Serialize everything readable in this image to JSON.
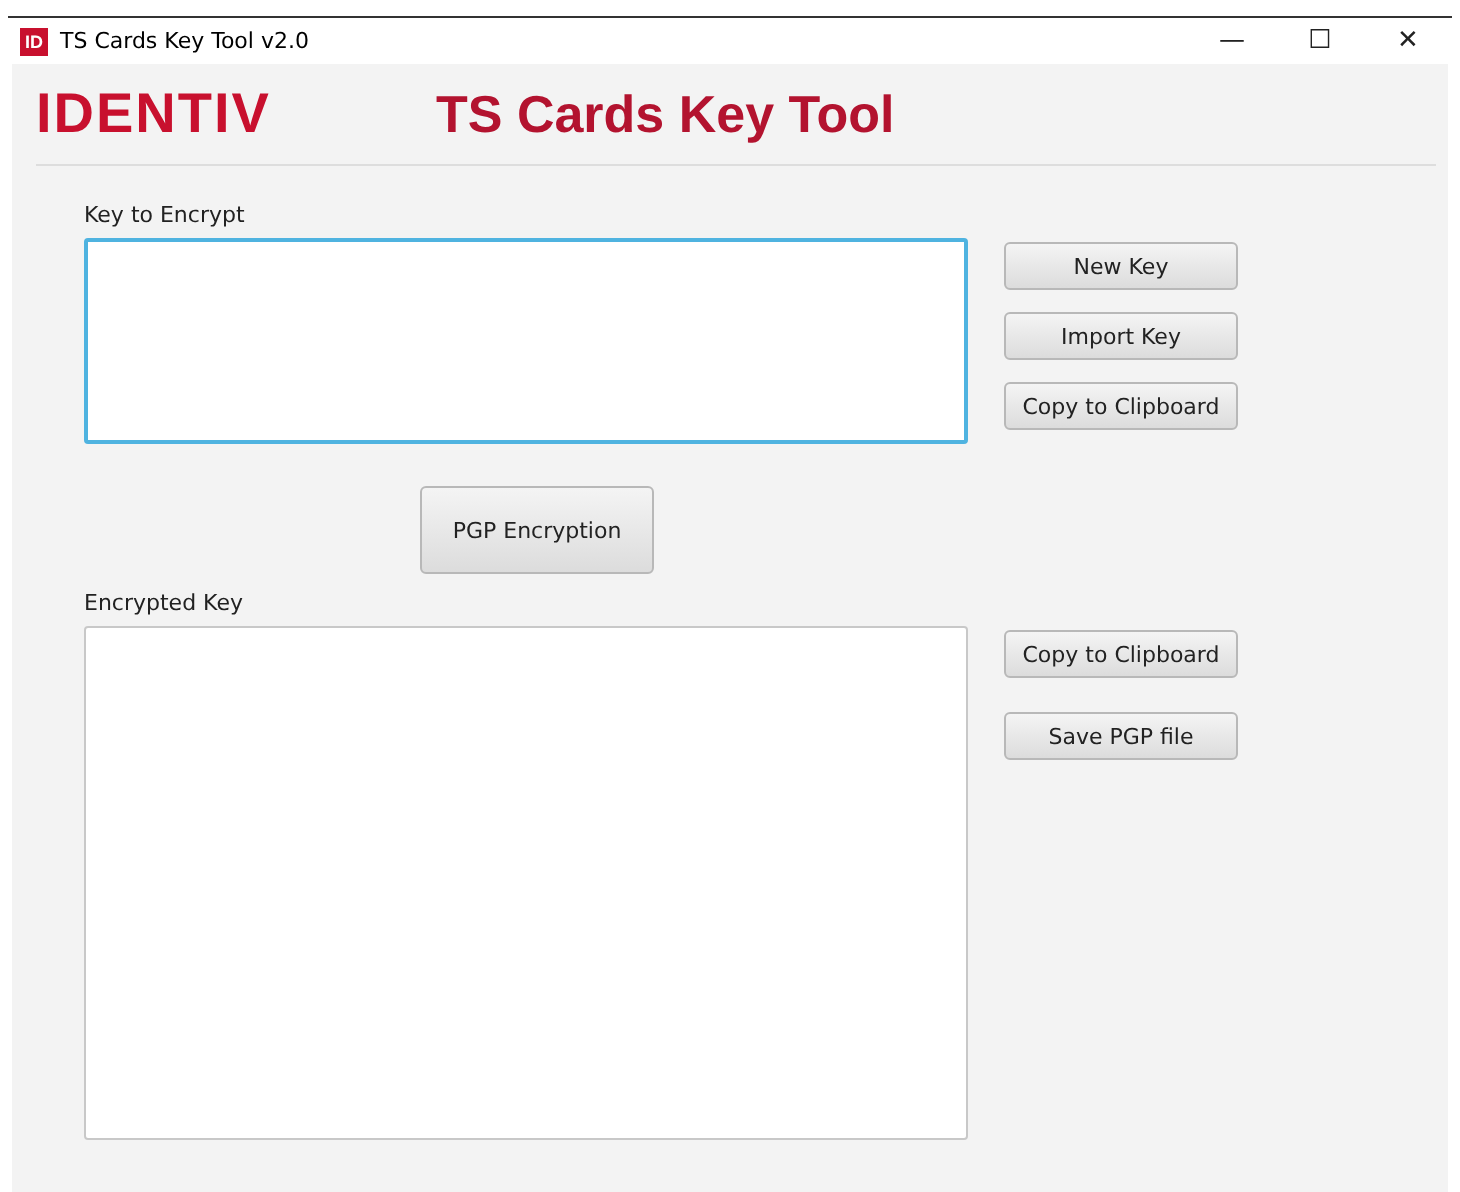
{
  "window": {
    "icon_text": "ID",
    "title": "TS Cards Key Tool v2.0",
    "controls": [
      "—",
      "☐",
      "✕"
    ]
  },
  "header": {
    "logo": "IDENTIV",
    "title": "TS Cards Key Tool"
  },
  "input_section": {
    "label": "Key to Encrypt",
    "focused": true,
    "buttons": [
      "New Key",
      "Import Key",
      "Copy to Clipboard"
    ]
  },
  "encrypt_button": "PGP Encryption",
  "output_section": {
    "label": "Encrypted Key",
    "focused": false,
    "buttons": [
      "Copy to Clipboard",
      "Save PGP file"
    ]
  }
}
